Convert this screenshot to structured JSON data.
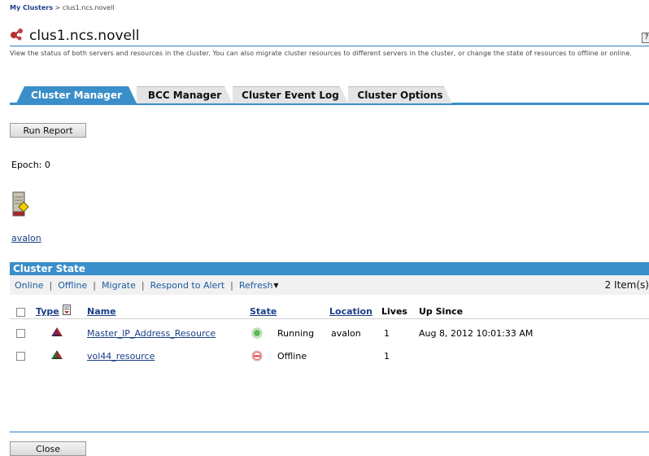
{
  "breadcrumb": {
    "root": "My Clusters",
    "sep": " > ",
    "current": "clus1.ncs.novell"
  },
  "page": {
    "title": "clus1.ncs.novell",
    "help": "?",
    "description": "View the status of both servers and resources in the cluster. You can also migrate cluster resources to different servers in the cluster, or change the state of resources to offline or online."
  },
  "tabs": [
    "Cluster Manager",
    "BCC Manager",
    "Cluster Event Log",
    "Cluster Options"
  ],
  "buttons": {
    "run_report": "Run Report",
    "close": "Close"
  },
  "epoch": "Epoch:  0",
  "server": {
    "name": "avalon"
  },
  "cluster_state": {
    "title": "Cluster State",
    "actions": [
      "Online",
      "Offline",
      "Migrate",
      "Respond to Alert",
      "Refresh"
    ],
    "separator": "|",
    "item_count": "2 Item(s)",
    "columns": {
      "type": "Type",
      "name": "Name",
      "state": "State",
      "location": "Location",
      "lives": "Lives",
      "up_since": "Up Since"
    },
    "rows": [
      {
        "name": "Master_IP_Address_Resource",
        "state": "Running",
        "location": "avalon",
        "lives": "1",
        "up_since": "Aug 8, 2012 10:01:33 AM",
        "status_color": "#5cb85c"
      },
      {
        "name": "vol44_resource",
        "state": "Offline",
        "location": "",
        "lives": "1",
        "up_since": "",
        "status_color": "#d9534f"
      }
    ]
  }
}
